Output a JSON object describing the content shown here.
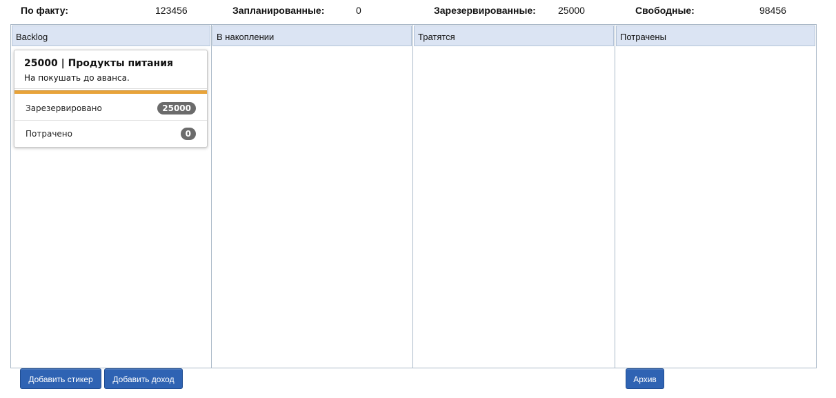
{
  "summary": {
    "fact_label": "По факту:",
    "fact_value": "123456",
    "planned_label": "Запланированные:",
    "planned_value": "0",
    "reserved_label": "Зарезервированные:",
    "reserved_value": "25000",
    "free_label": "Свободные:",
    "free_value": "98456"
  },
  "columns": [
    {
      "title": "Backlog"
    },
    {
      "title": "В накоплении"
    },
    {
      "title": "Тратятся"
    },
    {
      "title": "Потрачены"
    }
  ],
  "card": {
    "title": "25000 | Продукты питания",
    "description": "На покушать до аванса.",
    "accent_color": "#e8a33a",
    "rows": [
      {
        "label": "Зарезервировано",
        "value": "25000"
      },
      {
        "label": "Потрачено",
        "value": "0"
      }
    ]
  },
  "buttons": {
    "add_sticker": "Добавить стикер",
    "add_income": "Добавить доход",
    "archive": "Архив"
  },
  "colors": {
    "header_bg": "#dbe4f3",
    "button_bg": "#2f63b3",
    "badge_bg": "#6b6b6b"
  }
}
